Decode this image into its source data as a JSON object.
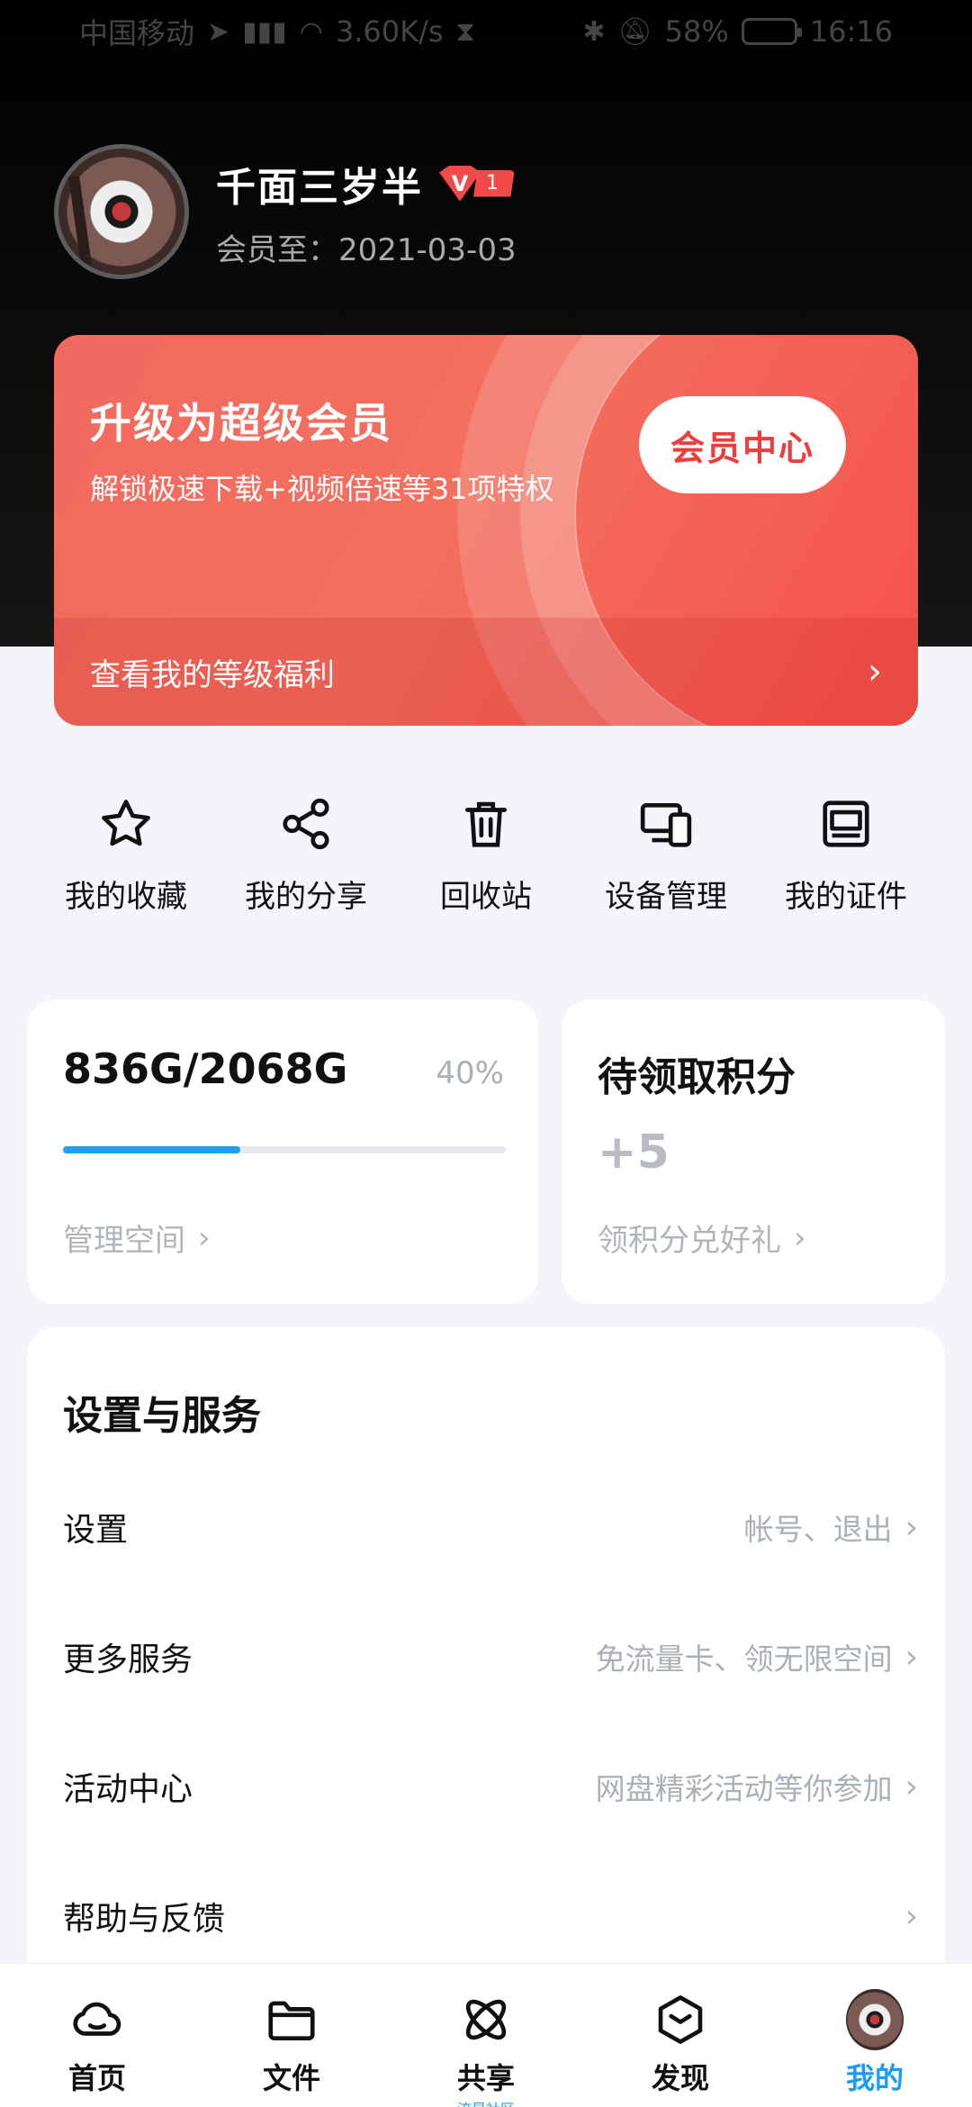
{
  "status_bar": {
    "carrier": "中国移动",
    "net_speed": "3.60K/s",
    "battery": "58%",
    "time": "16:16"
  },
  "profile": {
    "name": "千面三岁半",
    "vip_level": "1",
    "member_until": "会员至：2021-03-03"
  },
  "vip_card": {
    "title": "升级为超级会员",
    "subtitle": "解锁极速下载+视频倍速等31项特权",
    "button": "会员中心",
    "level_link": "查看我的等级福利"
  },
  "quick_actions": [
    {
      "label": "我的收藏",
      "icon": "star-icon"
    },
    {
      "label": "我的分享",
      "icon": "share-icon"
    },
    {
      "label": "回收站",
      "icon": "trash-icon"
    },
    {
      "label": "设备管理",
      "icon": "devices-icon"
    },
    {
      "label": "我的证件",
      "icon": "id-card-icon"
    }
  ],
  "storage": {
    "amount": "836G/2068G",
    "percent": "40%",
    "fill_fraction": 0.4,
    "manage_link": "管理空间"
  },
  "points": {
    "title": "待领取积分",
    "value": "+5",
    "link": "领积分兑好礼"
  },
  "settings": {
    "title": "设置与服务",
    "rows": [
      {
        "title": "设置",
        "hint": "帐号、退出"
      },
      {
        "title": "更多服务",
        "hint": "免流量卡、领无限空间"
      },
      {
        "title": "活动中心",
        "hint": "网盘精彩活动等你参加"
      },
      {
        "title": "帮助与反馈",
        "hint": ""
      }
    ]
  },
  "bottom_nav": [
    {
      "label": "首页",
      "icon": "cloud-icon"
    },
    {
      "label": "文件",
      "icon": "folder-icon"
    },
    {
      "label": "共享",
      "sublabel": "流星社区",
      "icon": "atom-icon"
    },
    {
      "label": "发现",
      "icon": "cube-icon"
    },
    {
      "label": "我的",
      "icon": "avatar"
    }
  ],
  "colors": {
    "accent": "#1a9cf0",
    "vip_red": "#f04a4a",
    "progress": "#1da1ec"
  }
}
